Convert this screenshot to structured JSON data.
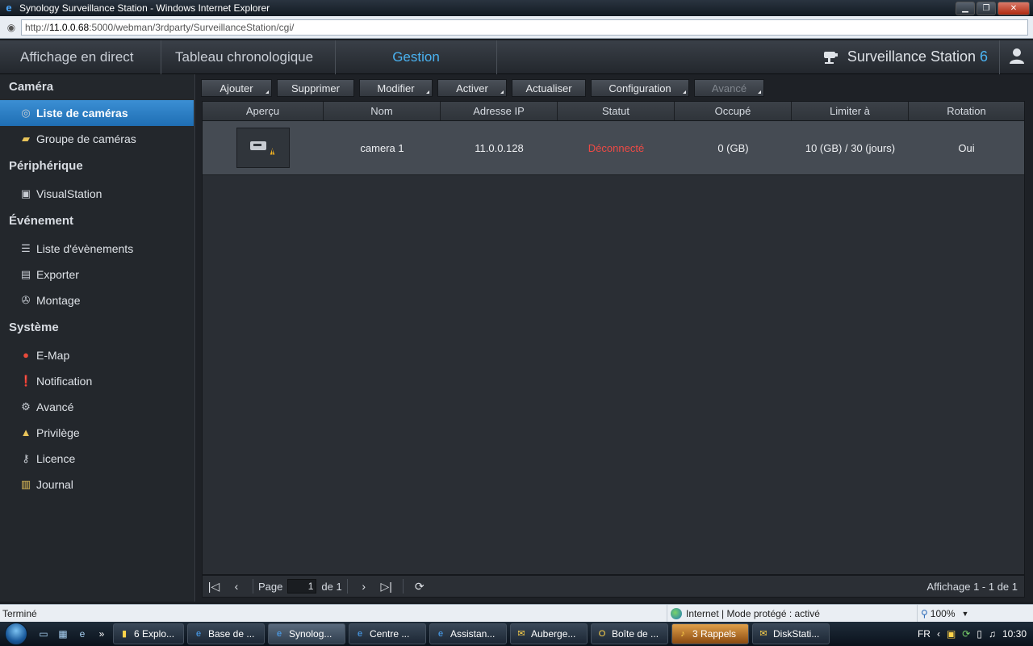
{
  "browser": {
    "title": "Synology Surveillance Station - Windows Internet Explorer",
    "url_prefix": "http://",
    "url_host": "11.0.0.68",
    "url_rest": ":5000/webman/3rdparty/SurveillanceStation/cgi/",
    "status_text": "Terminé",
    "zone_text": "Internet | Mode protégé : activé",
    "zoom": "100%"
  },
  "header": {
    "tabs": [
      {
        "label": "Affichage en direct"
      },
      {
        "label": "Tableau chronologique"
      },
      {
        "label": "Gestion"
      }
    ],
    "brand": "Surveillance Station",
    "brand_version": "6"
  },
  "sidebar": {
    "sections": [
      {
        "title": "Caméra",
        "items": [
          {
            "label": "Liste de caméras",
            "icon": "camera-icon",
            "active": true
          },
          {
            "label": "Groupe de caméras",
            "icon": "folder-icon"
          }
        ]
      },
      {
        "title": "Périphérique",
        "items": [
          {
            "label": "VisualStation",
            "icon": "monitor-icon"
          }
        ]
      },
      {
        "title": "Événement",
        "items": [
          {
            "label": "Liste d'évènements",
            "icon": "list-icon"
          },
          {
            "label": "Exporter",
            "icon": "film-icon"
          },
          {
            "label": "Montage",
            "icon": "reel-icon"
          }
        ]
      },
      {
        "title": "Système",
        "items": [
          {
            "label": "E-Map",
            "icon": "map-pin-icon"
          },
          {
            "label": "Notification",
            "icon": "notification-icon"
          },
          {
            "label": "Avancé",
            "icon": "gear-icon"
          },
          {
            "label": "Privilège",
            "icon": "lock-icon"
          },
          {
            "label": "Licence",
            "icon": "key-icon"
          },
          {
            "label": "Journal",
            "icon": "journal-icon"
          }
        ]
      }
    ]
  },
  "toolbar": {
    "add": "Ajouter",
    "delete": "Supprimer",
    "edit": "Modifier",
    "enable": "Activer",
    "refresh": "Actualiser",
    "config": "Configuration",
    "advanced": "Avancé"
  },
  "grid": {
    "columns": [
      "Aperçu",
      "Nom",
      "Adresse IP",
      "Statut",
      "Occupé",
      "Limiter à",
      "Rotation"
    ],
    "rows": [
      {
        "name": "camera 1",
        "ip": "11.0.0.128",
        "status": "Déconnecté",
        "used": "0 (GB)",
        "limit": "10 (GB) / 30 (jours)",
        "rotation": "Oui"
      }
    ]
  },
  "pager": {
    "page_label": "Page",
    "page_value": "1",
    "of_label": "de 1",
    "display": "Affichage 1 - 1 de 1"
  },
  "taskbar": {
    "tasks": [
      {
        "label": "6 Explo..."
      },
      {
        "label": "Base de ..."
      },
      {
        "label": "Synolog..."
      },
      {
        "label": "Centre ..."
      },
      {
        "label": "Assistan..."
      },
      {
        "label": "Auberge..."
      },
      {
        "label": "Boîte de ..."
      },
      {
        "label": "3 Rappels"
      },
      {
        "label": "DiskStati..."
      }
    ],
    "lang": "FR",
    "clock": "10:30"
  }
}
